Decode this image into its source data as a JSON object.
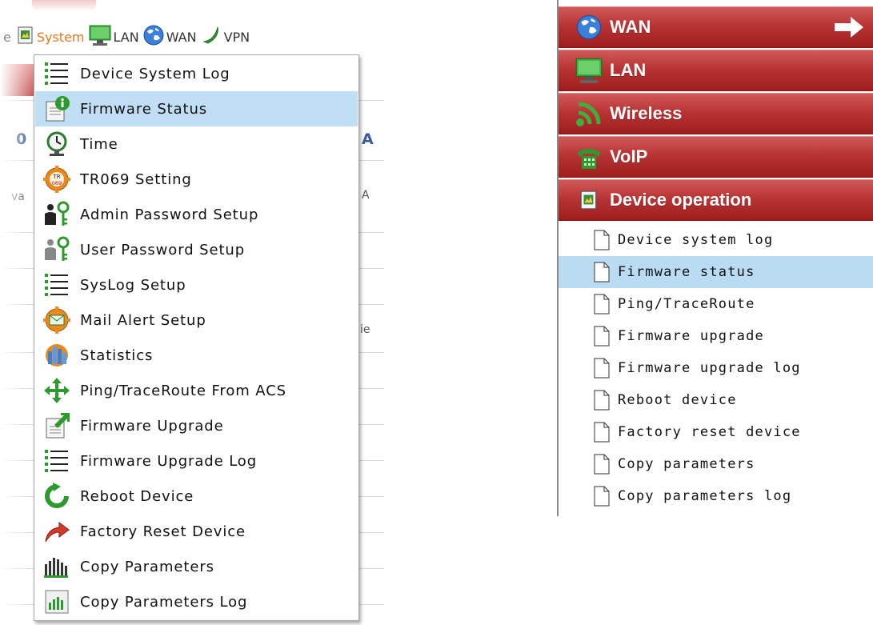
{
  "toolbar": {
    "fragment": "e",
    "items": [
      {
        "label": "System",
        "icon": "system-icon",
        "active": true
      },
      {
        "label": "LAN",
        "icon": "monitor-icon",
        "active": false
      },
      {
        "label": "WAN",
        "icon": "globe-icon",
        "active": false
      },
      {
        "label": "VPN",
        "icon": "vpn-icon",
        "active": false
      }
    ]
  },
  "dropdown": {
    "items": [
      {
        "label": "Device System Log",
        "icon": "list-icon"
      },
      {
        "label": "Firmware Status",
        "icon": "info-doc-icon",
        "selected": true
      },
      {
        "label": "Time",
        "icon": "clock-icon"
      },
      {
        "label": "TR069 Setting",
        "icon": "tr069-gear-icon"
      },
      {
        "label": "Admin Password Setup",
        "icon": "admin-key-icon"
      },
      {
        "label": "User Password Setup",
        "icon": "user-key-icon"
      },
      {
        "label": "SysLog Setup",
        "icon": "list-icon"
      },
      {
        "label": "Mail Alert Setup",
        "icon": "mail-gear-icon"
      },
      {
        "label": "Statistics",
        "icon": "statistics-icon"
      },
      {
        "label": "Ping/TraceRoute From ACS",
        "icon": "move-arrows-icon"
      },
      {
        "label": "Firmware Upgrade",
        "icon": "upload-doc-icon"
      },
      {
        "label": "Firmware Upgrade Log",
        "icon": "list-icon"
      },
      {
        "label": "Reboot Device",
        "icon": "reboot-icon"
      },
      {
        "label": "Factory Reset Device",
        "icon": "reset-arrow-icon"
      },
      {
        "label": "Copy Parameters",
        "icon": "copy-bars-icon"
      },
      {
        "label": "Copy Parameters Log",
        "icon": "copy-log-icon"
      }
    ]
  },
  "background_fragments": {
    "left_blue_1": "0",
    "right_blue_1": "A",
    "left_text_1": "va",
    "right_text_1": "A",
    "right_text_2": "ie"
  },
  "sidebar": {
    "categories": [
      {
        "label": "WAN",
        "icon": "globe-icon"
      },
      {
        "label": "LAN",
        "icon": "monitor-icon"
      },
      {
        "label": "Wireless",
        "icon": "wireless-icon"
      },
      {
        "label": "VoIP",
        "icon": "phone-icon"
      },
      {
        "label": "Device operation",
        "icon": "system-icon"
      }
    ],
    "subitems": [
      {
        "label": "Device system log"
      },
      {
        "label": "Firmware status",
        "selected": true
      },
      {
        "label": "Ping/TraceRoute"
      },
      {
        "label": "Firmware upgrade"
      },
      {
        "label": "Firmware upgrade log"
      },
      {
        "label": "Reboot device"
      },
      {
        "label": "Factory reset device"
      },
      {
        "label": "Copy parameters"
      },
      {
        "label": "Copy parameters log"
      }
    ]
  },
  "colors": {
    "accent_orange": "#e8781e",
    "selection_blue": "#c1dff4",
    "category_red": "#b93434"
  }
}
